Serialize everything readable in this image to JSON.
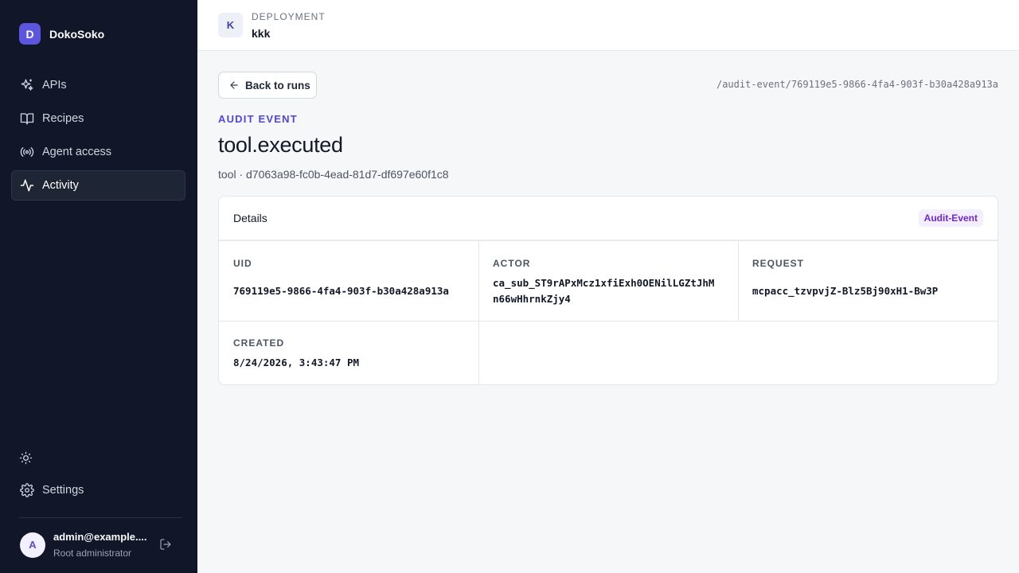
{
  "brand": {
    "logo_letter": "D",
    "name": "DokoSoko"
  },
  "sidebar": {
    "items": [
      {
        "label": "APIs",
        "icon": "sparkle-icon",
        "active": false
      },
      {
        "label": "Recipes",
        "icon": "book-icon",
        "active": false
      },
      {
        "label": "Agent access",
        "icon": "broadcast-icon",
        "active": false
      },
      {
        "label": "Activity",
        "icon": "activity-icon",
        "active": true
      }
    ],
    "theme_toggle_icon": "sun-icon",
    "settings_label": "Settings",
    "user": {
      "avatar_letter": "A",
      "email": "admin@example....",
      "role": "Root administrator"
    }
  },
  "header": {
    "badge_letter": "K",
    "label": "DEPLOYMENT",
    "name": "kkk"
  },
  "page": {
    "back_label": "Back to runs",
    "route": "/audit-event/769119e5-9866-4fa4-903f-b30a428a913a",
    "eyebrow": "AUDIT EVENT",
    "title": "tool.executed",
    "subtitle": "tool · d7063a98-fc0b-4ead-81d7-df697e60f1c8"
  },
  "details": {
    "title": "Details",
    "badge": "Audit-Event",
    "fields": {
      "uid": {
        "label": "UID",
        "value": "769119e5-9866-4fa4-903f-b30a428a913a"
      },
      "actor": {
        "label": "ACTOR",
        "value_line1": "ca_sub_ST9rAPxMcz1xfiExh0OENilLGZtJhM",
        "value_line2": "n66wHhrnkZjy4"
      },
      "request": {
        "label": "REQUEST",
        "value": "mcpacc_tzvpvjZ-Blz5Bj90xH1-Bw3P"
      },
      "created": {
        "label": "CREATED",
        "value": "8/24/2026, 3:43:47 PM"
      }
    }
  },
  "colors": {
    "sidebar_bg": "#111729",
    "accent": "#4f46e5",
    "brand": "#5b55e0",
    "badge_text": "#6d28d9"
  }
}
